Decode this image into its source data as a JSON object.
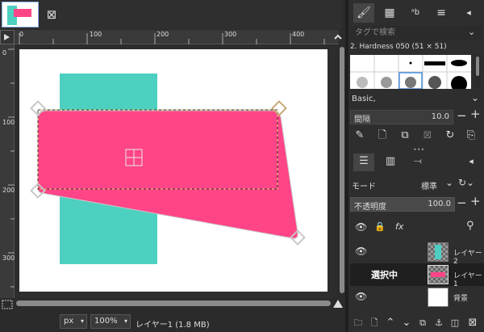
{
  "canvas": {
    "ruler_top_labels": [
      "0",
      "100",
      "200",
      "300",
      "400"
    ],
    "ruler_left_labels": [
      "0",
      "100",
      "200",
      "300"
    ]
  },
  "status": {
    "unit": "px",
    "zoom": "100%",
    "layer_info": "レイヤー1 (1.8 MB)"
  },
  "brushes": {
    "search_placeholder": "タグで検索",
    "selected_brush": "2. Hardness 050 (51 × 51)"
  },
  "tool_options": {
    "preset": "Basic,",
    "spacing_label": "間隔",
    "spacing_value": "10.0"
  },
  "layers": {
    "mode_label": "モード",
    "mode_value": "標準",
    "opacity_label": "不透明度",
    "opacity_value": "100.0",
    "items": [
      {
        "name": "レイヤー2",
        "visible": true
      },
      {
        "name": "レイヤー1",
        "visible": true,
        "selected_label": "選択中"
      },
      {
        "name": "背景",
        "visible": true
      }
    ]
  },
  "colors": {
    "teal": "#4dd0c0",
    "pink": "#ff4588",
    "accent": "#8ab4f8"
  }
}
